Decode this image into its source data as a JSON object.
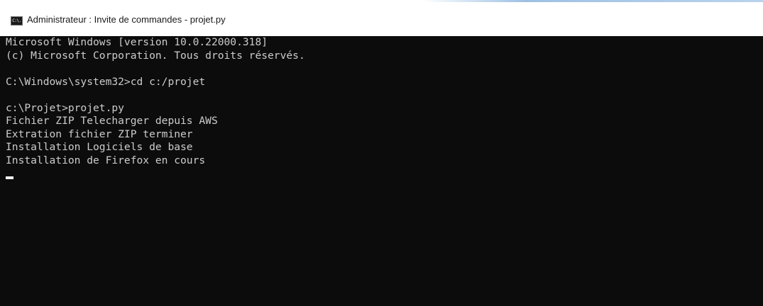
{
  "window": {
    "title": "Administrateur : Invite de commandes - projet.py",
    "icon": "cmd-icon",
    "icon_glyph": "C:\\."
  },
  "console": {
    "lines": [
      "Microsoft Windows [version 10.0.22000.318]",
      "(c) Microsoft Corporation. Tous droits réservés.",
      "",
      "C:\\Windows\\system32>cd c:/projet",
      "",
      "c:\\Projet>projet.py",
      "Fichier ZIP Telecharger depuis AWS",
      "Extration fichier ZIP terminer",
      "Installation Logiciels de base",
      "Installation de Firefox en cours"
    ]
  },
  "colors": {
    "console_background": "#0c0c0c",
    "console_text": "#cccccc",
    "titlebar_background": "#ffffff",
    "cursor": "#f2f2f2"
  }
}
